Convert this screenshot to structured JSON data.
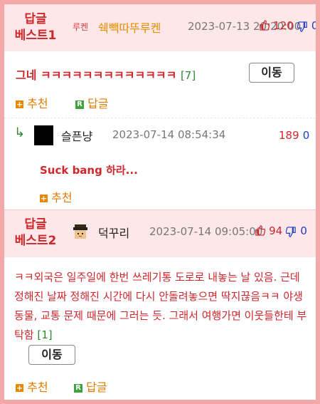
{
  "best1": {
    "label_line1": "답글",
    "label_line2": "베스트1",
    "nickname": "쉑빽따뚜루켄",
    "avatar_text": "루켄",
    "date": "2023-07-13 20:20:00",
    "up_count": "120",
    "down_count": "0",
    "comment_text": "그네 ㅋㅋㅋㅋㅋㅋㅋㅋㅋㅋㅋㅋㅋ",
    "reply_count": "[7]",
    "move_label": "이동",
    "recommend_label": "추천",
    "reply_label": "답글"
  },
  "reply": {
    "arrow": "↳",
    "nickname": "슬픈냥",
    "date": "2023-07-14 08:54:34",
    "up_count": "189",
    "down_count": "0",
    "comment_text": "Suck bang 하라...",
    "recommend_label": "추천"
  },
  "best2": {
    "label_line1": "답글",
    "label_line2": "베스트2",
    "nickname": "덕꾸리",
    "date": "2023-07-14 09:05:00",
    "up_count": "94",
    "down_count": "0",
    "comment_text": "ㅋㅋ외국은 일주일에 한번 쓰레기통 도로로 내놓는 날 있음. 근데 정해진 날짜 정해진 시간에 다시 안돌려놓으면 딱지끊음ㅋㅋ 야생동물, 교통 문제 때문에 그러는 듯. 그래서 여행가면 이웃들한테 부탁함",
    "reply_count": "[1]",
    "move_label": "이동",
    "recommend_label": "추천",
    "reply_label": "답글"
  },
  "colors": {
    "frame": "#f4a9a9",
    "best_bg": "#fde7e8",
    "best_red": "#d0262b",
    "link_green": "#2f8a2f",
    "action_orange": "#e07b00",
    "down_blue": "#1c3cc7"
  },
  "icons": {
    "thumbs_up": "thumbs-up-icon",
    "thumbs_down": "thumbs-down-icon",
    "plus": "plus-icon",
    "reply_badge": "reply-badge-icon"
  }
}
